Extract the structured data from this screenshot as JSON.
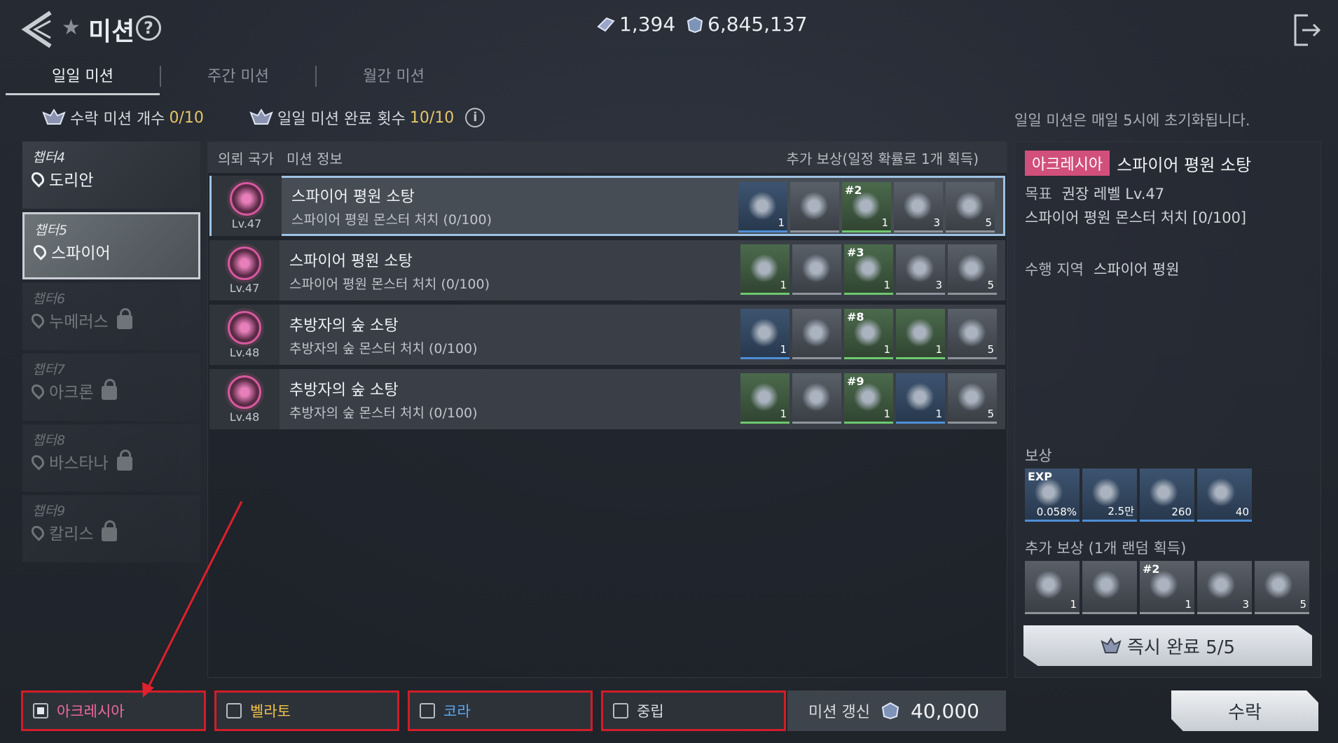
{
  "header": {
    "title": "미션",
    "currency_a": "1,394",
    "currency_b": "6,845,137"
  },
  "tabs": [
    {
      "label": "일일 미션",
      "active": true
    },
    {
      "label": "주간 미션"
    },
    {
      "label": "월간 미션"
    }
  ],
  "counters": {
    "accepted_label": "수락 미션 개수",
    "accepted_value": "0/10",
    "completed_label": "일일 미션 완료 횟수",
    "completed_value": "10/10",
    "reset_note": "일일 미션은 매일 5시에 초기화됩니다."
  },
  "chapters": [
    {
      "num": "챕터4",
      "name": "도리안",
      "locked": false,
      "selected": false
    },
    {
      "num": "챕터5",
      "name": "스파이어",
      "locked": false,
      "selected": true
    },
    {
      "num": "챕터6",
      "name": "누메러스",
      "locked": true
    },
    {
      "num": "챕터7",
      "name": "아크론",
      "locked": true
    },
    {
      "num": "챕터8",
      "name": "바스타나",
      "locked": true
    },
    {
      "num": "챕터9",
      "name": "칼리스",
      "locked": true
    }
  ],
  "list": {
    "col_nation": "의뢰 국가",
    "col_info": "미션 정보",
    "col_extra": "추가 보상(일정 확률로 1개 획득)"
  },
  "missions": [
    {
      "level": "Lv.47",
      "title": "스파이어 평원 소탕",
      "sub": "스파이어 평원 몬스터 처치 (0/100)",
      "rewards": [
        {
          "q": "1",
          "c": "blue"
        },
        {
          "q": "",
          "c": ""
        },
        {
          "tag": "#2",
          "q": "1",
          "c": "green"
        },
        {
          "q": "3",
          "c": ""
        },
        {
          "q": "5",
          "c": ""
        }
      ]
    },
    {
      "level": "Lv.47",
      "title": "스파이어 평원 소탕",
      "sub": "스파이어 평원 몬스터 처치 (0/100)",
      "rewards": [
        {
          "q": "1",
          "c": "green"
        },
        {
          "q": "",
          "c": ""
        },
        {
          "tag": "#3",
          "q": "1",
          "c": "green"
        },
        {
          "q": "3",
          "c": ""
        },
        {
          "q": "5",
          "c": ""
        }
      ]
    },
    {
      "level": "Lv.48",
      "title": "추방자의 숲 소탕",
      "sub": "추방자의 숲 몬스터 처치 (0/100)",
      "rewards": [
        {
          "q": "1",
          "c": "blue"
        },
        {
          "q": "",
          "c": ""
        },
        {
          "tag": "#8",
          "q": "1",
          "c": "green"
        },
        {
          "q": "1",
          "c": "green"
        },
        {
          "q": "5",
          "c": ""
        }
      ]
    },
    {
      "level": "Lv.48",
      "title": "추방자의 숲 소탕",
      "sub": "추방자의 숲 몬스터 처치 (0/100)",
      "rewards": [
        {
          "q": "1",
          "c": "green"
        },
        {
          "q": "",
          "c": ""
        },
        {
          "tag": "#9",
          "q": "1",
          "c": "green"
        },
        {
          "q": "1",
          "c": "blue"
        },
        {
          "q": "5",
          "c": ""
        }
      ]
    }
  ],
  "detail": {
    "nation": "아크레시아",
    "title": "스파이어 평원 소탕",
    "goal_label": "목표",
    "goal_value": "권장 레벨 Lv.47",
    "goal_desc": "스파이어 평원 몬스터 처치 [0/100]",
    "area_label": "수행 지역",
    "area_value": "스파이어 평원",
    "reward_label": "보상",
    "rewards": [
      {
        "tag": "EXP",
        "q": "0.058%"
      },
      {
        "tag": "",
        "q": "2.5만"
      },
      {
        "tag": "",
        "q": "260"
      },
      {
        "tag": "",
        "q": "40"
      }
    ],
    "extra_label": "추가 보상 (1개 랜덤 획득)",
    "extra": [
      {
        "q": "1"
      },
      {
        "q": ""
      },
      {
        "tag": "#2",
        "q": "1"
      },
      {
        "q": "3"
      },
      {
        "q": "5"
      }
    ],
    "instant_label": "즉시 완료 5/5"
  },
  "filters": [
    {
      "label": "아크레시아",
      "checked": true,
      "color": "#f06a9a"
    },
    {
      "label": "벨라토",
      "checked": false,
      "color": "#f0c24a"
    },
    {
      "label": "코라",
      "checked": false,
      "color": "#5aa8f0"
    },
    {
      "label": "중립",
      "checked": false,
      "color": "#d9dde3"
    }
  ],
  "refresh": {
    "label": "미션 갱신",
    "cost": "40,000"
  },
  "accept_label": "수락"
}
